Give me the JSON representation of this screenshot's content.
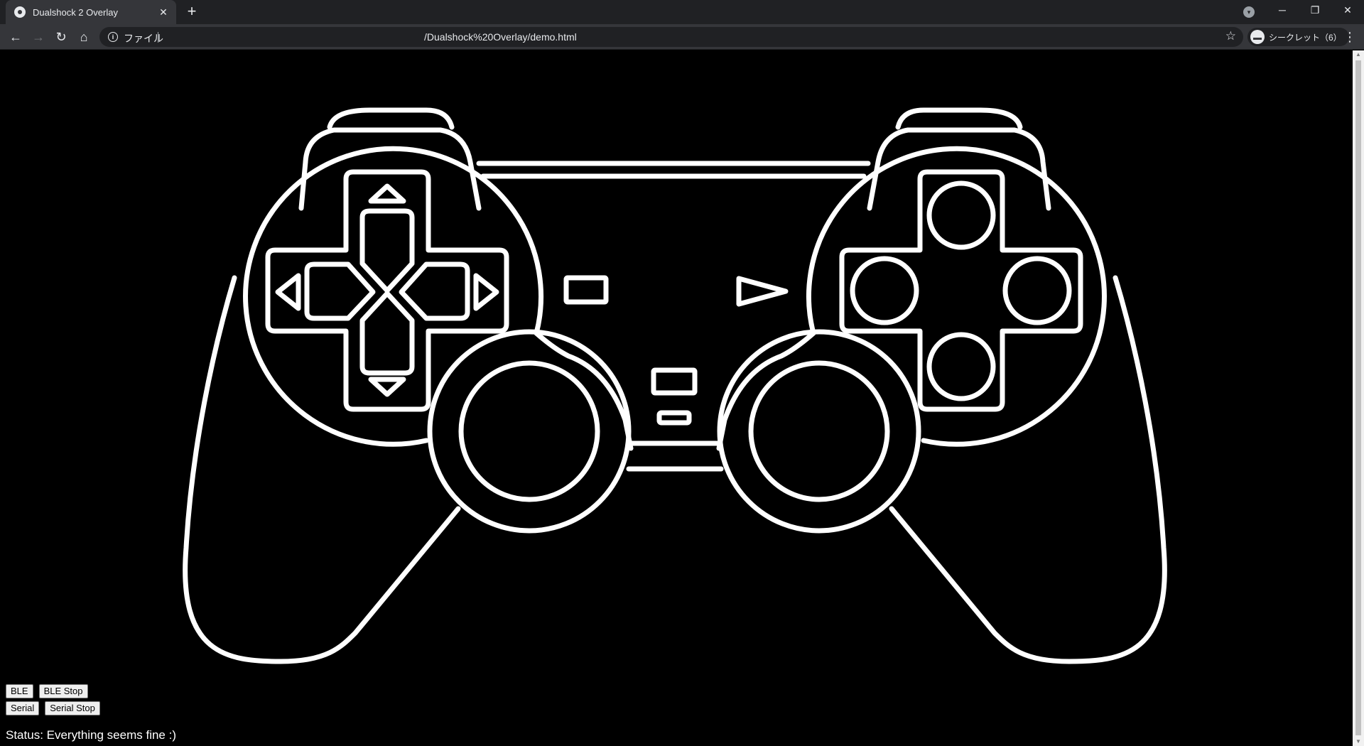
{
  "browser": {
    "tab": {
      "title": "Dualshock 2 Overlay",
      "close": "✕"
    },
    "new_tab": "+",
    "window_controls": {
      "minimize": "─",
      "restore": "❐",
      "close": "✕"
    },
    "nav": {
      "back": "←",
      "forward": "→",
      "reload": "↻",
      "home": "⌂"
    },
    "address": {
      "scheme_label": "ファイル",
      "url": "/Dualshock%20Overlay/demo.html"
    },
    "profile": {
      "label": "シークレット（6）"
    },
    "menu": "⋮"
  },
  "page": {
    "buttons_row1": [
      "BLE",
      "BLE Stop"
    ],
    "buttons_row2": [
      "Serial",
      "Serial Stop"
    ],
    "status": "Status: Everything seems fine :)"
  },
  "colors": {
    "background": "#000000",
    "outline": "#ffffff"
  }
}
